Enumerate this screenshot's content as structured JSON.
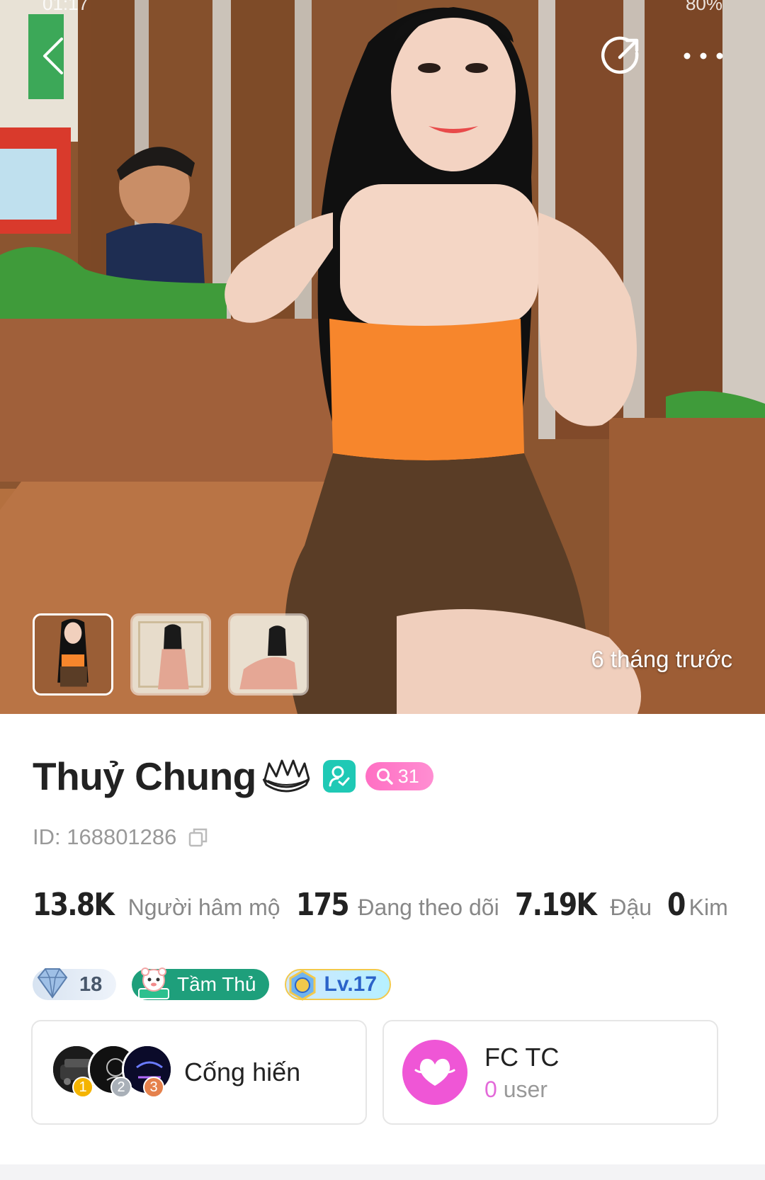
{
  "status_bar": {
    "time": "01:17",
    "battery": "80%"
  },
  "hero": {
    "time_ago": "6 tháng trước",
    "thumbnails": [
      {
        "name": "thumb-1",
        "active": true
      },
      {
        "name": "thumb-2",
        "active": false
      },
      {
        "name": "thumb-3",
        "active": false
      }
    ]
  },
  "profile": {
    "name": "Thuỷ Chung",
    "level_badge": "31",
    "id_label": "ID: 168801286"
  },
  "stats": [
    {
      "value": "13.8K",
      "label": "Người hâm mộ"
    },
    {
      "value": "175",
      "label": "Đang theo dõi"
    },
    {
      "value": "7.19K",
      "label": "Đậu"
    },
    {
      "value": "0",
      "label": "Kim"
    }
  ],
  "badges": {
    "diamond": "18",
    "title": "Tầm Thủ",
    "level": "Lv.17"
  },
  "contribution_card": {
    "title": "Cống hiến",
    "ranks": [
      "1",
      "2",
      "3"
    ]
  },
  "fan_club_card": {
    "name": "FC TC",
    "count": "0",
    "unit": "user"
  },
  "colors": {
    "verify": "#1fc9b5",
    "level_pill": "#ff6fc3",
    "fan_club": "#ef56d6",
    "title_badge": "#1e9f7b",
    "lv_text": "#2b63c9"
  }
}
